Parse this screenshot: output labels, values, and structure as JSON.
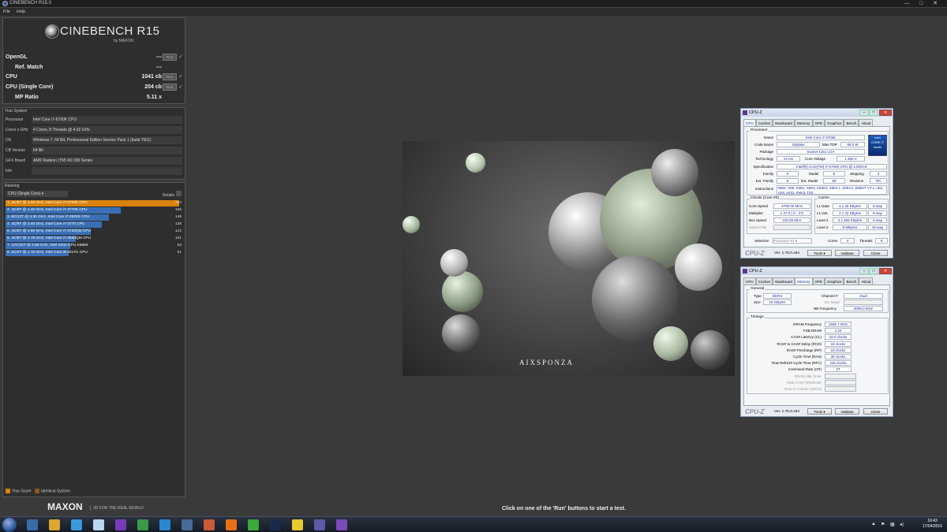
{
  "window": {
    "title": "CINEBENCH R15.0",
    "menu": [
      "File",
      "Help"
    ],
    "controls": [
      "—",
      "□",
      "✕"
    ]
  },
  "logo": {
    "name": "CINEBENCH R15",
    "by": "by MAXON"
  },
  "scores": [
    {
      "label": "OpenGL",
      "value": "---",
      "run": "Run",
      "has_run": true
    },
    {
      "label": "Ref. Match",
      "value": "---",
      "run": "",
      "has_run": false
    },
    {
      "label": "CPU",
      "value": "1041 cb",
      "run": "Run",
      "has_run": true
    },
    {
      "label": "CPU (Single Core)",
      "value": "204 cb",
      "run": "Run",
      "has_run": true
    },
    {
      "label": "MP Ratio",
      "value": "5.11 x",
      "run": "",
      "has_run": false
    }
  ],
  "your_system": {
    "header": "Your System",
    "rows": [
      {
        "key": "Processor",
        "value": "Intel Core i7-6700K CPU"
      },
      {
        "key": "Cores x GHz",
        "value": "4 Cores, 8 Threads @ 4.02 GHz"
      },
      {
        "key": "OS",
        "value": "Windows 7, 64 Bit, Professional Edition Service Pack 1 (build 7601)"
      },
      {
        "key": "CB Version",
        "value": "64 Bit"
      },
      {
        "key": "GFX Board",
        "value": "AMD Radeon (TM) R9 390 Series"
      },
      {
        "key": "Info",
        "value": ""
      }
    ]
  },
  "ranking": {
    "header": "Ranking",
    "selected": "CPU (Single Core)",
    "details": "Details",
    "max": 204,
    "rows": [
      {
        "label": "1. 4C/8T @ 4.02 GHz, Intel Core i7-6700K CPU",
        "score": 204,
        "own": true
      },
      {
        "label": "2. 4C/8T @ 4.40 GHz, Intel Core i7-4770K CPU",
        "score": 165,
        "own": false
      },
      {
        "label": "3. 6C/12T @ 3.30 GHz,  Intel Core i7-3930K CPU",
        "score": 148,
        "own": false
      },
      {
        "label": "4. 4C/8T @ 3.40 GHz,  Intel Core i7-3770 CPU",
        "score": 138,
        "own": false
      },
      {
        "label": "5. 4C/8T @ 2.60 GHz, Intel Core i7-3720QM CPU",
        "score": 122,
        "own": false
      },
      {
        "label": "6. 4C/8T @ 2.79 GHz,  Intel Core i7-3840QM CPU",
        "score": 101,
        "own": false
      },
      {
        "label": "7. 12C/24T @ 2.66 GHz, Intel Xeon CPU X5650",
        "score": 93,
        "own": false
      },
      {
        "label": "8. 2C/4T @ 1.70 GHz,  Intel Core i5-3317U CPU",
        "score": 91,
        "own": false
      }
    ],
    "legend": [
      "Your Score",
      "Identical System"
    ]
  },
  "colors": {
    "own": "#d9820e",
    "other": "#3a6fb5",
    "identical": "#8a5a1e"
  },
  "footer": {
    "brand": "MAXON",
    "slogan": "3D FOR THE REAL WORLD",
    "hint": "Click on one of the 'Run' buttons to start a test."
  },
  "render": {
    "watermark": "AIXSPONZA"
  },
  "cpuz1": {
    "title": "CPU-Z",
    "tabs": [
      "CPU",
      "Caches",
      "Mainboard",
      "Memory",
      "SPD",
      "Graphics",
      "Bench",
      "About"
    ],
    "active_tab": "CPU",
    "processor": {
      "group": "Processor",
      "name_label": "Name",
      "name": "Intel Core i7 6700K",
      "codename_label": "Code Name",
      "codename": "Skylake",
      "tdp_label": "Max TDP",
      "tdp": "95.0 W",
      "package_label": "Package",
      "package": "Socket 1151 LGA",
      "tech_label": "Technology",
      "tech": "14 nm",
      "voltage_label": "Core Voltage",
      "voltage": "1.360 V",
      "spec_label": "Specification",
      "spec": "Intel(R) Core(TM) i7-6700K CPU @ 4.00GHz",
      "family_label": "Family",
      "family": "6",
      "model_label": "Model",
      "model": "E",
      "stepping_label": "Stepping",
      "stepping": "3",
      "extfamily_label": "Ext. Family",
      "extfamily": "6",
      "extmodel_label": "Ext. Model",
      "extmodel": "5E",
      "revision_label": "Revision",
      "revision": "R0",
      "instr_label": "Instructions",
      "instr": "MMX, SSE, SSE2, SSE3, SSSE3, SSE4.1, SSE4.2, EM64T, VT-x, AES, AVX, AVX2, FMA3, TSX",
      "intel_logo": [
        "intel",
        "CORE i7",
        "inside"
      ]
    },
    "clocks": {
      "group": "Clocks (Core #0)",
      "core_speed_label": "Core Speed",
      "core_speed": "4700.00 MHz",
      "multiplier_label": "Multiplier",
      "multiplier": "x 47.0 ( 8 - 47)",
      "bus_label": "Bus Speed",
      "bus": "100.00 MHz",
      "fsb_label": "Rated FSB",
      "fsb": ""
    },
    "cache": {
      "group": "Cache",
      "l1d_label": "L1 Data",
      "l1d": "4 x 32 KBytes",
      "l1d_way": "8-way",
      "l1i_label": "L1 Inst.",
      "l1i": "4 x 32 KBytes",
      "l1i_way": "8-way",
      "l2_label": "Level 2",
      "l2": "4 x 256 KBytes",
      "l2_way": "4-way",
      "l3_label": "Level 3",
      "l3": "8 MBytes",
      "l3_way": "16-way"
    },
    "selection_label": "Selection",
    "selection": "Processor #1",
    "cores_label": "Cores",
    "cores": "4",
    "threads_label": "Threads",
    "threads": "8",
    "version": "Ver. 1.75.0.x64",
    "tools": "Tools",
    "validate": "Validate",
    "close": "Close"
  },
  "cpuz2": {
    "title": "CPU-Z",
    "tabs": [
      "CPU",
      "Caches",
      "Mainboard",
      "Memory",
      "SPD",
      "Graphics",
      "Bench",
      "About"
    ],
    "active_tab": "Memory",
    "general": {
      "group": "General",
      "type_label": "Type",
      "type": "DDR4",
      "channel_label": "Channel #",
      "channel": "Dual",
      "size_label": "Size",
      "size": "16 GBytes",
      "dcmode_label": "DC Mode",
      "dcmode": "",
      "nb_label": "NB Frequency",
      "nb": "4099.0 MHz"
    },
    "timings": {
      "group": "Timings",
      "rows": [
        {
          "label": "DRAM Frequency",
          "value": "1599.7 MHz",
          "enabled": true
        },
        {
          "label": "FSB:DRAM",
          "value": "1:24",
          "enabled": true
        },
        {
          "label": "CAS# Latency (CL)",
          "value": "16.0 clocks",
          "enabled": true
        },
        {
          "label": "RAS# to CAS# Delay (RCD)",
          "value": "18 clocks",
          "enabled": true
        },
        {
          "label": "RAS# Precharge (RP)",
          "value": "18 clocks",
          "enabled": true
        },
        {
          "label": "Cycle Time (RAS)",
          "value": "38 clocks",
          "enabled": true
        },
        {
          "label": "Row Refresh Cycle Time (RFC)",
          "value": "416 clocks",
          "enabled": true
        },
        {
          "label": "Command Rate (CR)",
          "value": "2T",
          "enabled": true
        },
        {
          "label": "DRAM Idle Timer",
          "value": "",
          "enabled": false
        },
        {
          "label": "Total CAS# (tRDRAM)",
          "value": "",
          "enabled": false
        },
        {
          "label": "Row To Column (tRCD)",
          "value": "",
          "enabled": false
        }
      ]
    },
    "version": "Ver. 1.75.0.x64",
    "tools": "Tools",
    "validate": "Validate",
    "close": "Close"
  },
  "taskbar": {
    "clock_time": "16:43",
    "clock_date": "17/04/2016",
    "icons": [
      "explorer-icon",
      "folder-icon",
      "notepad-icon",
      "paint-icon",
      "visual-studio-icon",
      "spreadsheet-icon",
      "network-icon",
      "system-icon",
      "tools-icon",
      "firefox-icon",
      "xbox-icon",
      "steam-icon",
      "folders-icon",
      "cinebench-icon",
      "cpuz-icon"
    ]
  }
}
